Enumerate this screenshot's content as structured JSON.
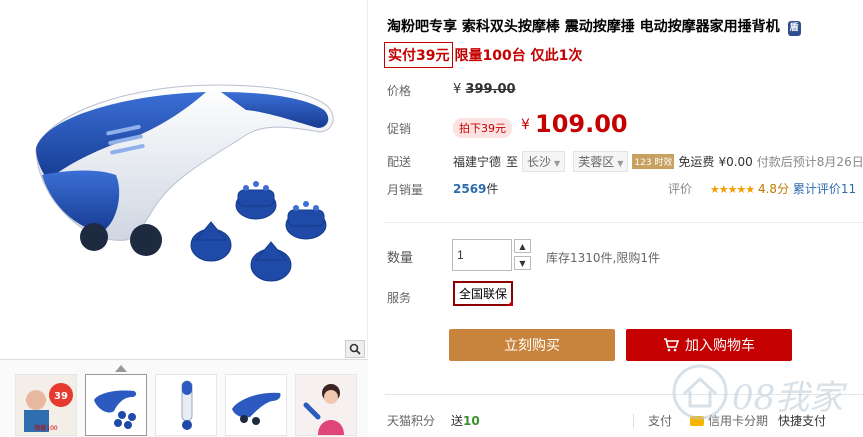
{
  "product": {
    "title": "淘粉吧专享 索科双头按摩棒 震动按摩捶 电动按摩器家用捶背机",
    "badge": "盾",
    "promo_box": "实付39元",
    "promo_rest": "限量100台 仅此1次"
  },
  "price": {
    "label": "价格",
    "currency": "¥",
    "original": "399.00"
  },
  "promotion": {
    "label": "促销",
    "coupon": "拍下39元",
    "currency": "¥",
    "price": "109.00"
  },
  "shipping": {
    "label": "配送",
    "from": "福建宁德",
    "to_label": "至",
    "city": "长沙",
    "district": "芙蓉区",
    "tag": "123 时效",
    "free_label": "免运费",
    "fee": "¥0.00",
    "estimate": "付款后预计8月26日"
  },
  "sales": {
    "label": "月销量",
    "count": "2569",
    "unit": "件",
    "rating_label": "评价",
    "stars": "★★★★★",
    "score": "4.8分",
    "reviews_link": "累计评价11"
  },
  "quantity": {
    "label": "数量",
    "value": "1",
    "up": "▲",
    "down": "▼",
    "stock": "库存1310件,限购1件"
  },
  "service": {
    "label": "服务",
    "tag": "全国联保"
  },
  "actions": {
    "buy_label": "立刻购买",
    "cart_label": "加入购物车"
  },
  "points": {
    "label": "天猫积分",
    "prefix": "送",
    "value": "10"
  },
  "payment": {
    "label": "支付",
    "card": "信用卡分期",
    "quick": "快捷支付"
  },
  "watermark": {
    "text": "08我家"
  },
  "thumb_promo": {
    "price": "39",
    "sub": "限量100"
  },
  "colors": {
    "brand_red": "#c40000",
    "buy_button": "#c8843c",
    "cart_button": "#c40000",
    "product_blue": "#1f4aa8",
    "link_blue": "#2d6bae"
  }
}
